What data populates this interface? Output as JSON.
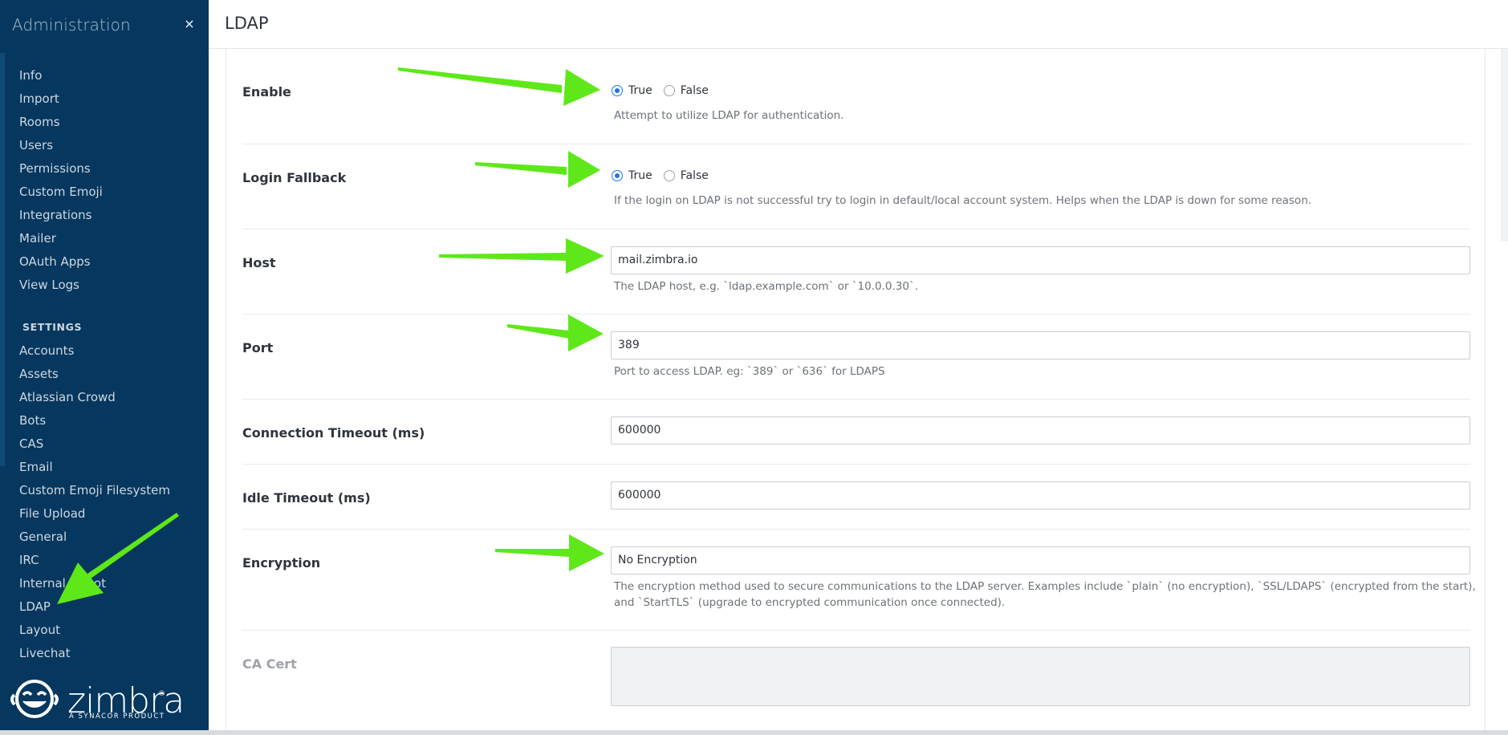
{
  "sidebar": {
    "title": "Administration",
    "close_icon": "×",
    "items": [
      {
        "label": "Info"
      },
      {
        "label": "Import"
      },
      {
        "label": "Rooms"
      },
      {
        "label": "Users"
      },
      {
        "label": "Permissions"
      },
      {
        "label": "Custom Emoji"
      },
      {
        "label": "Integrations"
      },
      {
        "label": "Mailer"
      },
      {
        "label": "OAuth Apps"
      },
      {
        "label": "View Logs"
      }
    ],
    "settings_label": "SETTINGS",
    "settings_items": [
      {
        "label": "Accounts"
      },
      {
        "label": "Assets"
      },
      {
        "label": "Atlassian Crowd"
      },
      {
        "label": "Bots"
      },
      {
        "label": "CAS"
      },
      {
        "label": "Email"
      },
      {
        "label": "Custom Emoji Filesystem"
      },
      {
        "label": "File Upload"
      },
      {
        "label": "General"
      },
      {
        "label": "IRC"
      },
      {
        "label": "Internal Hubot"
      },
      {
        "label": "LDAP"
      },
      {
        "label": "Layout"
      },
      {
        "label": "Livechat"
      }
    ],
    "logo": {
      "word": "zimbra",
      "tagline": "A SYNACOR PRODUCT",
      "reg": "®"
    }
  },
  "page": {
    "title": "LDAP"
  },
  "settings": {
    "enable": {
      "label": "Enable",
      "true_label": "True",
      "false_label": "False",
      "selected": "True",
      "hint": "Attempt to utilize LDAP for authentication."
    },
    "login_fallback": {
      "label": "Login Fallback",
      "true_label": "True",
      "false_label": "False",
      "selected": "True",
      "hint": "If the login on LDAP is not successful try to login in default/local account system. Helps when the LDAP is down for some reason."
    },
    "host": {
      "label": "Host",
      "value": "mail.zimbra.io",
      "hint": "The LDAP host, e.g. `ldap.example.com` or `10.0.0.30`."
    },
    "port": {
      "label": "Port",
      "value": "389",
      "hint": "Port to access LDAP. eg: `389` or `636` for LDAPS"
    },
    "connection_timeout": {
      "label": "Connection Timeout (ms)",
      "value": "600000"
    },
    "idle_timeout": {
      "label": "Idle Timeout (ms)",
      "value": "600000"
    },
    "encryption": {
      "label": "Encryption",
      "value": "No Encryption",
      "hint_line1": "The encryption method used to secure communications to the LDAP server. Examples include `plain` (no encryption), `SSL/LDAPS` (encrypted from the start),",
      "hint_line2": "and `StartTLS` (upgrade to encrypted communication once connected)."
    },
    "ca_cert": {
      "label": "CA Cert",
      "value": ""
    }
  },
  "colors": {
    "sidebar_bg": "#06375e",
    "accent": "#1d74f5",
    "arrow": "#5ee81a"
  }
}
